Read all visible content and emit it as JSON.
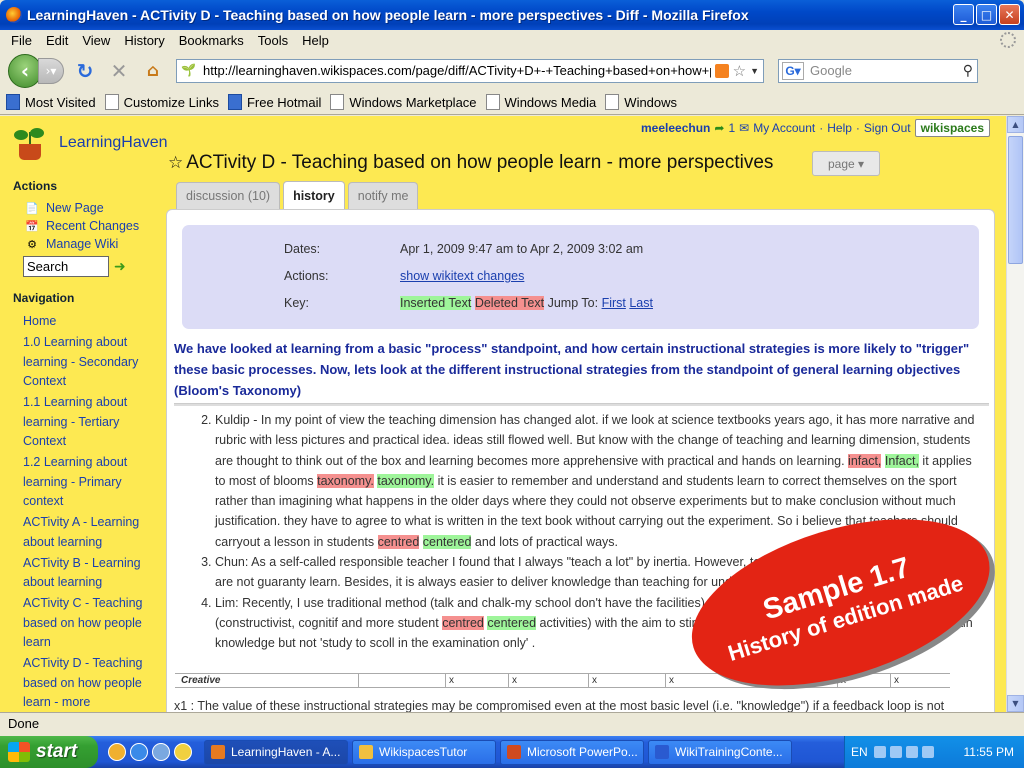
{
  "window": {
    "title": "LearningHaven - ACTivity D - Teaching based on how people learn - more perspectives - Diff - Mozilla Firefox"
  },
  "menu": [
    "File",
    "Edit",
    "View",
    "History",
    "Bookmarks",
    "Tools",
    "Help"
  ],
  "toolbar": {
    "url": "http://learninghaven.wikispaces.com/page/diff/ACTivity+D+-+Teaching+based+on+how+people+learn",
    "search_placeholder": "Google"
  },
  "bookmarks": [
    "Most Visited",
    "Customize Links",
    "Free Hotmail",
    "Windows Marketplace",
    "Windows Media",
    "Windows"
  ],
  "site": {
    "name": "LearningHaven"
  },
  "sidebar": {
    "actions_heading": "Actions",
    "actions": [
      "New Page",
      "Recent Changes",
      "Manage Wiki"
    ],
    "search_placeholder": "Search",
    "navigation_heading": "Navigation",
    "nav": [
      "Home",
      "1.0 Learning about learning - Secondary Context",
      "1.1 Learning about learning - Tertiary Context",
      "1.2 Learning about learning - Primary context",
      "ACTivity A - Learning about learning",
      "ACTivity B - Learning about learning",
      "ACTivity C - Teaching based on how people learn",
      "ACTivity D - Teaching based on how people learn - more"
    ]
  },
  "userbar": {
    "user": "meeleechun",
    "messages": "1",
    "my_account": "My Account",
    "help": "Help",
    "sign_out": "Sign Out",
    "wikispaces": "wikispaces"
  },
  "page": {
    "title": "ACTivity D - Teaching based on how people learn - more perspectives",
    "page_button": "page ▾",
    "tabs": [
      "discussion (10)",
      "history",
      "notify me"
    ]
  },
  "diff": {
    "dates_label": "Dates:",
    "dates": "Apr 1, 2009 9:47 am to Apr 2, 2009 3:02 am",
    "actions_label": "Actions:",
    "actions_link": "show wikitext changes",
    "key_label": "Key:",
    "inserted": "Inserted Text",
    "deleted": "Deleted Text",
    "jump_to": "Jump To:",
    "first": "First",
    "last": "Last"
  },
  "intro": "We have looked at learning from a basic \"process\" standpoint, and how certain instructional strategies is more likely to \"trigger\" these basic processes. Now, lets look at the different instructional strategies from the standpoint of general learning objectives (Bloom's Taxonomy)",
  "items": {
    "k1": "Kuldip - In my point of view the teaching dimension has changed alot. if we look at science textbooks years ago, it has more narrative and rubric with less pictures and practical idea. ideas still flowed well. But know with the change of teaching and learning dimension, students are thought to think out of the box and learning becomes more apprehensive with practical and hands on learning. ",
    "k_del1": "infact,",
    "k_ins1": "Infact,",
    "k2": " it applies to most of blooms ",
    "k_del2": "taxonomy.",
    "k_ins2": "taxonomy.",
    "k3": " it is easier to remember and understand and students learn to correct themselves on the sport rather than imagining what happens in the older days where they could not observe experiments but to make conclusion without much justification. they have to agree to what is written in the text book without carrying out the experiment. So i believe that teachers should carryout a lesson in students ",
    "k_del3": "centred",
    "k_ins3": "centered",
    "k4": " and lots of practical ways.",
    "c1": "Chun: As a self-called responsible teacher I found that I always \"teach a lot\" by inertia. However, teaching a lot doesn't mean the students are not guaranty learn. Besides, it is always easier to deliver knowledge than teaching for understanding and application.",
    "l1": "Lim: Recently, I use traditional method (talk and chalk-my school don't have the facilities) and I would like to use other teaching methods (constructivist, cognitif and more student ",
    "l_del": "centred",
    "l_ins": "centered",
    "l2": " activities) with the aim to stimulate the students' interests in learning as to gain knowledge but not 'study to scoll in the examination only' ."
  },
  "table_fragment": {
    "label": "Creative",
    "mark": "x"
  },
  "footnote": "x1 : The value of these instructional strategies may be compromised even at the most basic level (i.e. \"knowledge\") if a feedback loop is not",
  "stamp": {
    "line1": "Sample 1.7",
    "line2": "History of edition made"
  },
  "status": "Done",
  "taskbar": {
    "start": "start",
    "tasks": [
      "LearningHaven - A...",
      "WikispacesTutor",
      "Microsoft PowerPo...",
      "WikiTrainingConte..."
    ],
    "lang": "EN",
    "clock": "11:55 PM"
  },
  "colors": {
    "page_bg": "#fde952",
    "inserted": "#9ef59a",
    "deleted": "#f5908f",
    "link": "#1a3fae",
    "stamp": "#e32414"
  }
}
